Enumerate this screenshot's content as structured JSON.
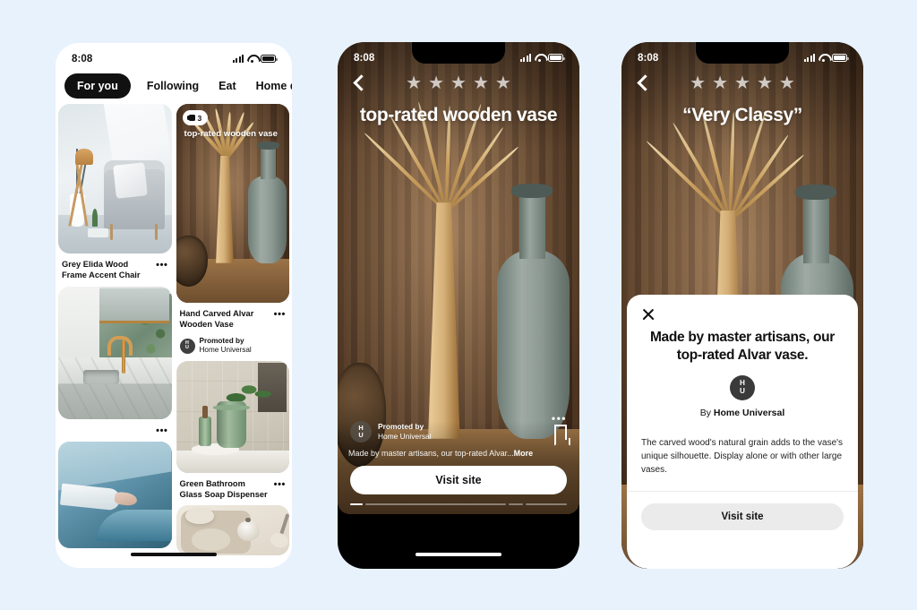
{
  "background_color": "#e8f2fc",
  "phone1": {
    "status": {
      "time": "8:08",
      "icons": [
        "cellular-icon",
        "wifi-icon",
        "battery-icon"
      ]
    },
    "tabs": [
      {
        "label": "For you",
        "active": true
      },
      {
        "label": "Following",
        "active": false
      },
      {
        "label": "Eat",
        "active": false
      },
      {
        "label": "Home decor",
        "active": false
      }
    ],
    "pins": [
      {
        "title": "Grey Elida Wood Frame Accent Chair",
        "overflow": "•••",
        "image": "living-room-grey-accent-chair"
      },
      {
        "overlay_title": "top-rated wooden vase",
        "badge_count": "3",
        "title": "Hand Carved Alvar Wooden Vase",
        "overflow": "•••",
        "promoted_label": "Promoted by",
        "promoted_brand": "Home Universal",
        "avatar_initials": [
          "H",
          "U"
        ],
        "image": "wooden-vase-on-table"
      },
      {
        "title": "",
        "overflow": "•••",
        "image": "marble-sink-gold-faucet"
      },
      {
        "title": "Green Bathroom Glass Soap Dispenser",
        "overflow": "•••",
        "image": "green-glass-soap-dispenser"
      },
      {
        "title": "",
        "overflow": "",
        "image": "blue-pool-hand"
      },
      {
        "title": "",
        "overflow": "",
        "image": "ceramic-tabletop"
      }
    ]
  },
  "phone2": {
    "status": {
      "time": "8:08"
    },
    "back_icon": "back-chevron-icon",
    "stars": "★ ★ ★ ★ ★",
    "star_count": 5,
    "headline": "top-rated wooden vase",
    "overflow": "•••",
    "promoted_label": "Promoted by",
    "promoted_brand": "Home Universal",
    "avatar_initials": [
      "H",
      "U"
    ],
    "save_icon": "bookmark-icon",
    "caption": "Made by master artisans, our top-rated Alvar...",
    "caption_more": "More",
    "cta_label": "Visit site",
    "progress": {
      "total_segments": 4,
      "active_index": 0
    }
  },
  "phone3": {
    "status": {
      "time": "8:08"
    },
    "back_icon": "back-chevron-icon",
    "stars": "★ ★ ★ ★ ★",
    "star_count": 5,
    "headline": "“Very Classy”",
    "card": {
      "close_icon": "close-icon",
      "title": "Made by master artisans, our top-rated Alvar vase.",
      "avatar_initials": [
        "H",
        "U"
      ],
      "by_prefix": "By ",
      "by_brand": "Home Universal",
      "body": "The carved wood's natural grain adds to the vase's unique silhouette. Display alone or with other large vases.",
      "cta_label": "Visit site"
    }
  }
}
